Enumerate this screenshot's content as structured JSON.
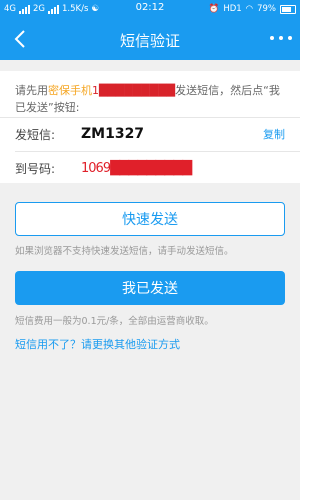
{
  "status_bar": {
    "network1": "4G",
    "network2": "2G",
    "speed": "1.5K/s",
    "time": "02:12",
    "hd": "HD1",
    "battery": "79%"
  },
  "header": {
    "title": "短信验证"
  },
  "instruction": {
    "prefix": "请先用",
    "highlight": "密保手机",
    "redacted": "1█████████",
    "suffix": "发送短信，然后点“我已发送”按钮:"
  },
  "sms": {
    "send_label": "发短信:",
    "code": "ZM1327",
    "copy_label": "复制",
    "to_label": "到号码:",
    "to_value": "1069█████████"
  },
  "buttons": {
    "quick_send": "快速发送",
    "quick_note": "如果浏览器不支持快速发送短信，请手动发送短信。",
    "sent": "我已发送",
    "fee_note": "短信费用一般为0.1元/条，全部由运营商收取。"
  },
  "alt_link": "短信用不了？请更换其他验证方式",
  "colors": {
    "accent": "#1a9bf0",
    "highlight": "#f5a623",
    "redacted": "#d8232a"
  }
}
